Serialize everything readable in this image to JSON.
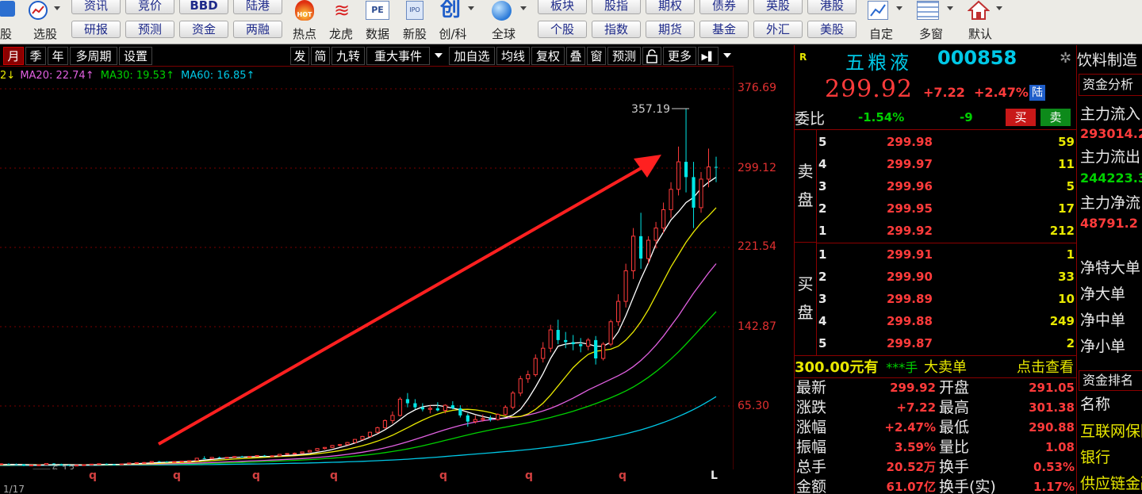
{
  "colors": {
    "up": "#ff3b3b",
    "down": "#00d000",
    "ma5": "#ffffff",
    "ma10": "#e8e800",
    "ma20": "#e060e0",
    "ma30": "#00d000",
    "ma60": "#00c8e6",
    "arrow": "#ff2020"
  },
  "toolbar": {
    "icon_groups": [
      {
        "label": "股",
        "icon": "stock-select-icon"
      },
      {
        "label": "选股",
        "icon": "trend-icon"
      },
      {
        "label": "热点",
        "icon": "hot-icon"
      },
      {
        "label": "龙虎",
        "icon": "dragon-icon"
      },
      {
        "label": "数据",
        "icon": "pe-data-icon"
      },
      {
        "label": "新股",
        "icon": "ipo-icon"
      },
      {
        "label": "创/科",
        "icon": "chuang-icon"
      },
      {
        "label": "全球",
        "icon": "globe-icon"
      },
      {
        "label": "自定",
        "icon": "custom-icon"
      },
      {
        "label": "多窗",
        "icon": "multiwindow-icon"
      },
      {
        "label": "默认",
        "icon": "home-icon"
      }
    ],
    "buttons_top": [
      "资讯",
      "竞价",
      "BBD",
      "陆港",
      "板块",
      "股指",
      "期权",
      "债券",
      "英股",
      "港股"
    ],
    "buttons_bottom": [
      "研报",
      "预测",
      "资金",
      "两融",
      "个股",
      "指数",
      "期货",
      "基金",
      "外汇",
      "美股"
    ],
    "badges": {
      "hot": "HOT",
      "pe": "PE",
      "ipo": "IPO",
      "chuang": "创"
    }
  },
  "kline_toolbar": {
    "periods": [
      "月",
      "季",
      "年",
      "多周期",
      "设置"
    ],
    "active_period": "月",
    "right_buttons": [
      "发",
      "简",
      "九转",
      "重大事件",
      "加自选",
      "均线",
      "复权",
      "叠",
      "窗",
      "预测",
      "更多"
    ],
    "lock_icon": "lock-icon",
    "more_arrow": "▶▌"
  },
  "ma_legend": [
    {
      "text": "2↓",
      "color": "#e8e800"
    },
    {
      "text": "MA20: 22.74↑",
      "color": "#e060e0"
    },
    {
      "text": "MA30: 19.53↑",
      "color": "#00d000"
    },
    {
      "text": "MA60: 16.85↑",
      "color": "#00c8e6"
    }
  ],
  "chart_data": {
    "type": "candlestick",
    "period": "monthly",
    "price_ticks": [
      "376.69",
      "299.12",
      "221.54",
      "142.87",
      "65.30"
    ],
    "annotations": {
      "max_label": "357.19",
      "min_label": "6.13"
    },
    "x_ticks": [
      "q",
      "q",
      "q",
      "q",
      "q",
      "q",
      "q",
      "L"
    ],
    "candles_ohlc": [
      [
        7,
        8.5,
        6.5,
        7.8
      ],
      [
        7.8,
        9,
        7.2,
        8.5
      ],
      [
        8.5,
        9,
        7.8,
        8.2
      ],
      [
        8.2,
        8.8,
        7.6,
        8
      ],
      [
        8,
        8.2,
        6.2,
        6.6
      ],
      [
        6.6,
        7.5,
        6.1,
        7.3
      ],
      [
        7.3,
        7.8,
        6.8,
        7.5
      ],
      [
        7.5,
        9,
        7.3,
        8.8
      ],
      [
        8.8,
        9.2,
        8,
        8.3
      ],
      [
        8.3,
        8.6,
        7,
        7.4
      ],
      [
        7.4,
        7.8,
        6.6,
        7
      ],
      [
        7,
        7.5,
        6.5,
        7.2
      ],
      [
        7.2,
        7.8,
        6.9,
        7.6
      ],
      [
        7.6,
        8.4,
        7.4,
        8.2
      ],
      [
        8.2,
        8.8,
        7.9,
        8.6
      ],
      [
        8.6,
        8.9,
        7.8,
        8
      ],
      [
        8,
        8.4,
        7.5,
        7.8
      ],
      [
        7.8,
        8.6,
        7.6,
        8.4
      ],
      [
        8.4,
        9.5,
        8.2,
        9.3
      ],
      [
        9.3,
        10,
        9,
        9.6
      ],
      [
        9.6,
        10.4,
        9.2,
        9.8
      ],
      [
        9.8,
        11,
        9.6,
        10.8
      ],
      [
        10.8,
        11.5,
        10.2,
        10.6
      ],
      [
        10.6,
        11.2,
        10,
        10.4
      ],
      [
        10.4,
        11,
        10,
        10.8
      ],
      [
        10.8,
        11.4,
        10.6,
        11.2
      ],
      [
        11.2,
        12,
        10.8,
        11.6
      ],
      [
        11.6,
        14.5,
        11.4,
        14
      ],
      [
        14,
        16,
        13.2,
        13.6
      ],
      [
        13.6,
        15,
        13,
        14.8
      ],
      [
        14.8,
        15.6,
        14,
        14.4
      ],
      [
        14.4,
        15,
        13.8,
        14.9
      ],
      [
        14.9,
        16,
        14.6,
        15.6
      ],
      [
        15.6,
        16.4,
        15,
        15.2
      ],
      [
        15.2,
        16,
        14.8,
        15.8
      ],
      [
        15.8,
        17,
        15.5,
        16.6
      ],
      [
        16.6,
        17.2,
        15.8,
        16.2
      ],
      [
        16.2,
        16.8,
        15.6,
        16.4
      ],
      [
        16.4,
        18,
        16.2,
        17.8
      ],
      [
        17.8,
        19,
        17.4,
        18.6
      ],
      [
        18.6,
        19.6,
        18.2,
        18.9
      ],
      [
        18.9,
        20.5,
        18.6,
        20.2
      ],
      [
        20.2,
        22,
        19.8,
        21.6
      ],
      [
        21.6,
        24,
        21,
        23.5
      ],
      [
        23.5,
        25,
        22.5,
        24.6
      ],
      [
        24.6,
        27,
        24,
        26.5
      ],
      [
        26.5,
        28,
        25.6,
        27.4
      ],
      [
        27.4,
        30,
        27,
        29.4
      ],
      [
        29.4,
        33,
        29,
        32.5
      ],
      [
        32.5,
        36,
        31.8,
        35.4
      ],
      [
        35.4,
        40,
        34.5,
        39.5
      ],
      [
        39.5,
        45,
        38.6,
        44
      ],
      [
        44,
        52,
        43,
        51
      ],
      [
        51,
        60,
        48,
        56
      ],
      [
        56,
        74,
        55,
        72
      ],
      [
        72,
        78,
        64,
        68
      ],
      [
        68,
        72,
        62,
        64
      ],
      [
        64,
        68,
        60,
        62
      ],
      [
        62,
        66,
        58,
        63
      ],
      [
        63,
        69,
        60,
        61
      ],
      [
        61,
        67,
        58,
        66
      ],
      [
        66,
        70,
        62,
        63
      ],
      [
        63,
        66,
        54,
        56
      ],
      [
        56,
        58,
        45,
        50
      ],
      [
        50,
        56,
        48,
        52
      ],
      [
        52,
        57,
        50,
        53
      ],
      [
        53,
        56,
        50,
        52
      ],
      [
        52,
        58,
        51,
        57
      ],
      [
        57,
        66,
        56,
        64
      ],
      [
        64,
        80,
        62,
        78
      ],
      [
        78,
        95,
        75,
        92
      ],
      [
        92,
        100,
        88,
        96
      ],
      [
        96,
        116,
        94,
        112
      ],
      [
        112,
        128,
        108,
        122
      ],
      [
        122,
        145,
        118,
        140
      ],
      [
        140,
        150,
        126,
        130
      ],
      [
        130,
        138,
        122,
        128
      ],
      [
        128,
        135,
        120,
        126
      ],
      [
        126,
        132,
        118,
        124
      ],
      [
        124,
        132,
        120,
        130
      ],
      [
        130,
        134,
        106,
        112
      ],
      [
        112,
        128,
        110,
        126
      ],
      [
        126,
        150,
        124,
        148
      ],
      [
        148,
        175,
        144,
        168
      ],
      [
        168,
        205,
        162,
        198
      ],
      [
        198,
        240,
        190,
        232
      ],
      [
        232,
        255,
        200,
        210
      ],
      [
        210,
        232,
        205,
        228
      ],
      [
        228,
        246,
        220,
        240
      ],
      [
        240,
        265,
        235,
        258
      ],
      [
        258,
        285,
        250,
        278
      ],
      [
        278,
        320,
        272,
        305
      ],
      [
        305,
        357.19,
        275,
        290
      ],
      [
        290,
        305,
        240,
        260
      ],
      [
        260,
        295,
        255,
        288
      ],
      [
        288,
        318,
        280,
        300
      ],
      [
        300,
        310,
        285,
        299.92
      ]
    ],
    "ma5": [
      7.5,
      7.7,
      7.9,
      8,
      7.8,
      7.6,
      7.4,
      7.5,
      7.7,
      7.8,
      7.7,
      7.5,
      7.4,
      7.5,
      7.7,
      7.9,
      8,
      8.1,
      8.4,
      8.7,
      9,
      9.4,
      9.8,
      10.1,
      10.4,
      10.6,
      10.9,
      11.5,
      12.2,
      12.9,
      13.6,
      14.3,
      14.8,
      15.1,
      15.3,
      15.6,
      15.8,
      15.9,
      16.3,
      16.7,
      17.2,
      17.8,
      18.6,
      19.8,
      21,
      22.6,
      24.5,
      26.6,
      28.9,
      31.6,
      34.6,
      38,
      42,
      46.5,
      52,
      57.5,
      61.5,
      64.5,
      65.8,
      66,
      64.6,
      63.2,
      61.6,
      59.2,
      57,
      55,
      53.5,
      52.8,
      53.8,
      56.5,
      62,
      72,
      84,
      97,
      112,
      124,
      126,
      127,
      127.5,
      126,
      124,
      124,
      128,
      138,
      154,
      172,
      190,
      206,
      224,
      236,
      248,
      256,
      265,
      270,
      279,
      285,
      290
    ],
    "ma10": [
      7.4,
      7.5,
      7.6,
      7.7,
      7.7,
      7.7,
      7.6,
      7.6,
      7.6,
      7.7,
      7.7,
      7.6,
      7.6,
      7.6,
      7.6,
      7.7,
      7.8,
      7.9,
      8.1,
      8.3,
      8.5,
      8.7,
      9,
      9.3,
      9.6,
      9.9,
      10.2,
      10.6,
      11.1,
      11.7,
      12.2,
      12.7,
      13.2,
      13.6,
      14.1,
      14.5,
      14.9,
      15.3,
      15.7,
      16.1,
      16.5,
      17,
      17.6,
      18.4,
      19.3,
      20.3,
      21.5,
      22.9,
      24.5,
      26.3,
      28.4,
      30.8,
      33.5,
      36.6,
      40.2,
      44,
      47.8,
      51.4,
      54.6,
      57.4,
      59.6,
      61,
      61.9,
      62,
      61.5,
      60.4,
      58.8,
      56.8,
      55.2,
      54.5,
      55,
      57.5,
      62,
      68,
      76,
      85,
      94,
      103,
      110,
      116,
      119,
      120,
      121,
      124,
      130,
      138,
      148,
      160,
      174,
      188,
      202,
      214,
      226,
      236,
      245,
      252,
      260
    ],
    "ma20": [
      7.3,
      7.3,
      7.4,
      7.4,
      7.5,
      7.5,
      7.5,
      7.5,
      7.5,
      7.6,
      7.6,
      7.6,
      7.6,
      7.6,
      7.6,
      7.7,
      7.7,
      7.7,
      7.8,
      7.9,
      8,
      8.1,
      8.3,
      8.4,
      8.6,
      8.8,
      9,
      9.2,
      9.5,
      9.8,
      10.1,
      10.4,
      10.7,
      11,
      11.3,
      11.6,
      11.9,
      12.2,
      12.5,
      12.9,
      13.3,
      13.7,
      14.2,
      14.8,
      15.4,
      16.1,
      16.9,
      17.8,
      18.8,
      19.9,
      21.2,
      22.6,
      24.2,
      26,
      28,
      30.2,
      32.5,
      34.9,
      37.3,
      39.7,
      42,
      44.2,
      46.2,
      48,
      49.5,
      50.8,
      51.8,
      52.6,
      53.2,
      54,
      55,
      56.4,
      58.2,
      60.4,
      63,
      66,
      69.4,
      73,
      77,
      81,
      84.5,
      88,
      91.5,
      95,
      99,
      104,
      110,
      117,
      125,
      134,
      144,
      154,
      165,
      176,
      186,
      196,
      205
    ],
    "ma30": [
      7.2,
      7.2,
      7.3,
      7.3,
      7.3,
      7.4,
      7.4,
      7.4,
      7.4,
      7.5,
      7.5,
      7.5,
      7.5,
      7.5,
      7.5,
      7.6,
      7.6,
      7.6,
      7.7,
      7.7,
      7.8,
      7.9,
      8,
      8.1,
      8.2,
      8.3,
      8.5,
      8.6,
      8.8,
      9,
      9.2,
      9.4,
      9.6,
      9.9,
      10.1,
      10.4,
      10.7,
      11,
      11.3,
      11.6,
      11.9,
      12.3,
      12.7,
      13.1,
      13.6,
      14.1,
      14.7,
      15.3,
      16,
      16.8,
      17.6,
      18.5,
      19.5,
      20.6,
      21.8,
      23.1,
      24.6,
      26.2,
      27.9,
      29.7,
      31.5,
      33.3,
      35.1,
      36.9,
      38.6,
      40.2,
      41.8,
      43.2,
      44.6,
      46,
      47.4,
      48.9,
      50.5,
      52.2,
      54,
      56,
      58,
      60.2,
      62.6,
      65,
      67.6,
      70.4,
      73.4,
      76.6,
      80,
      84,
      88.5,
      93.5,
      99,
      105,
      111.5,
      118.5,
      126,
      134,
      142,
      150,
      158
    ],
    "ma60": [
      6.8,
      6.8,
      6.8,
      6.9,
      6.9,
      6.9,
      6.9,
      7,
      7,
      7,
      7,
      7.1,
      7.1,
      7.1,
      7.1,
      7.2,
      7.2,
      7.2,
      7.3,
      7.3,
      7.3,
      7.4,
      7.4,
      7.5,
      7.5,
      7.6,
      7.6,
      7.7,
      7.8,
      7.8,
      7.9,
      8,
      8.1,
      8.2,
      8.3,
      8.4,
      8.5,
      8.6,
      8.8,
      8.9,
      9.1,
      9.2,
      9.4,
      9.6,
      9.8,
      10,
      10.2,
      10.5,
      10.7,
      11,
      11.3,
      11.6,
      12,
      12.3,
      12.7,
      13.1,
      13.6,
      14.1,
      14.6,
      15.1,
      15.7,
      16.3,
      16.9,
      17.5,
      18.1,
      18.7,
      19.3,
      19.9,
      20.5,
      21.1,
      21.8,
      22.5,
      23.3,
      24.1,
      25,
      26,
      27,
      28.1,
      29.3,
      30.5,
      31.8,
      33.2,
      34.7,
      36.3,
      38,
      39.9,
      41.9,
      44.1,
      46.5,
      49.1,
      51.9,
      55,
      58.3,
      61.9,
      65.8,
      70,
      74.5
    ]
  },
  "quote": {
    "badge": "R",
    "name": "五粮液",
    "code": "000858",
    "gear_icon": "gear-icon",
    "price": "299.92",
    "change": "+7.22",
    "pct": "+2.47%",
    "exchange": "陆",
    "weibi_label": "委比",
    "weibi_value": "-1.54%",
    "weicha_value": "-9",
    "buy_label": "买",
    "sell_label": "卖",
    "sell_side_label": [
      "卖",
      "盘"
    ],
    "buy_side_label": [
      "买",
      "盘"
    ],
    "asks": [
      {
        "level": "5",
        "price": "299.98",
        "vol": "59"
      },
      {
        "level": "4",
        "price": "299.97",
        "vol": "11"
      },
      {
        "level": "3",
        "price": "299.96",
        "vol": "5"
      },
      {
        "level": "2",
        "price": "299.95",
        "vol": "17"
      },
      {
        "level": "1",
        "price": "299.92",
        "vol": "212"
      }
    ],
    "bids": [
      {
        "level": "1",
        "price": "299.91",
        "vol": "1"
      },
      {
        "level": "2",
        "price": "299.90",
        "vol": "33"
      },
      {
        "level": "3",
        "price": "299.89",
        "vol": "10"
      },
      {
        "level": "4",
        "price": "299.88",
        "vol": "249"
      },
      {
        "level": "5",
        "price": "299.87",
        "vol": "2"
      }
    ],
    "bigorder": {
      "price": "300.00元有",
      "mark": "***手",
      "text": "大卖单",
      "action": "点击查看"
    },
    "details": [
      {
        "l": "最新",
        "v": "299.92",
        "l2": "开盘",
        "v2": "291.05"
      },
      {
        "l": "涨跌",
        "v": "+7.22",
        "l2": "最高",
        "v2": "301.38"
      },
      {
        "l": "涨幅",
        "v": "+2.47%",
        "l2": "最低",
        "v2": "290.88"
      },
      {
        "l": "振幅",
        "v": "3.59%",
        "l2": "量比",
        "v2": "1.08"
      },
      {
        "l": "总手",
        "v": "20.52万",
        "l2": "换手",
        "v2": "0.53%"
      },
      {
        "l": "金额",
        "v": "61.07亿",
        "l2": "换手(实)",
        "v2": "1.17%"
      }
    ]
  },
  "sector": {
    "title": "饮料制造",
    "tab": "资金分析",
    "flow": [
      {
        "label": "主力流入",
        "value": "293014.2"
      },
      {
        "label": "主力流出",
        "value": "244223.3"
      },
      {
        "label": "主力净流",
        "value": "48791.2"
      }
    ],
    "net": [
      "净特大单",
      "净大单",
      "净中单",
      "净小单"
    ],
    "rank_tab": "资金排名",
    "rank_header": "名称",
    "rank_items": [
      "互联网保险",
      "银行",
      "供应链金融"
    ]
  },
  "bottom": {
    "left_text": "1/17"
  }
}
